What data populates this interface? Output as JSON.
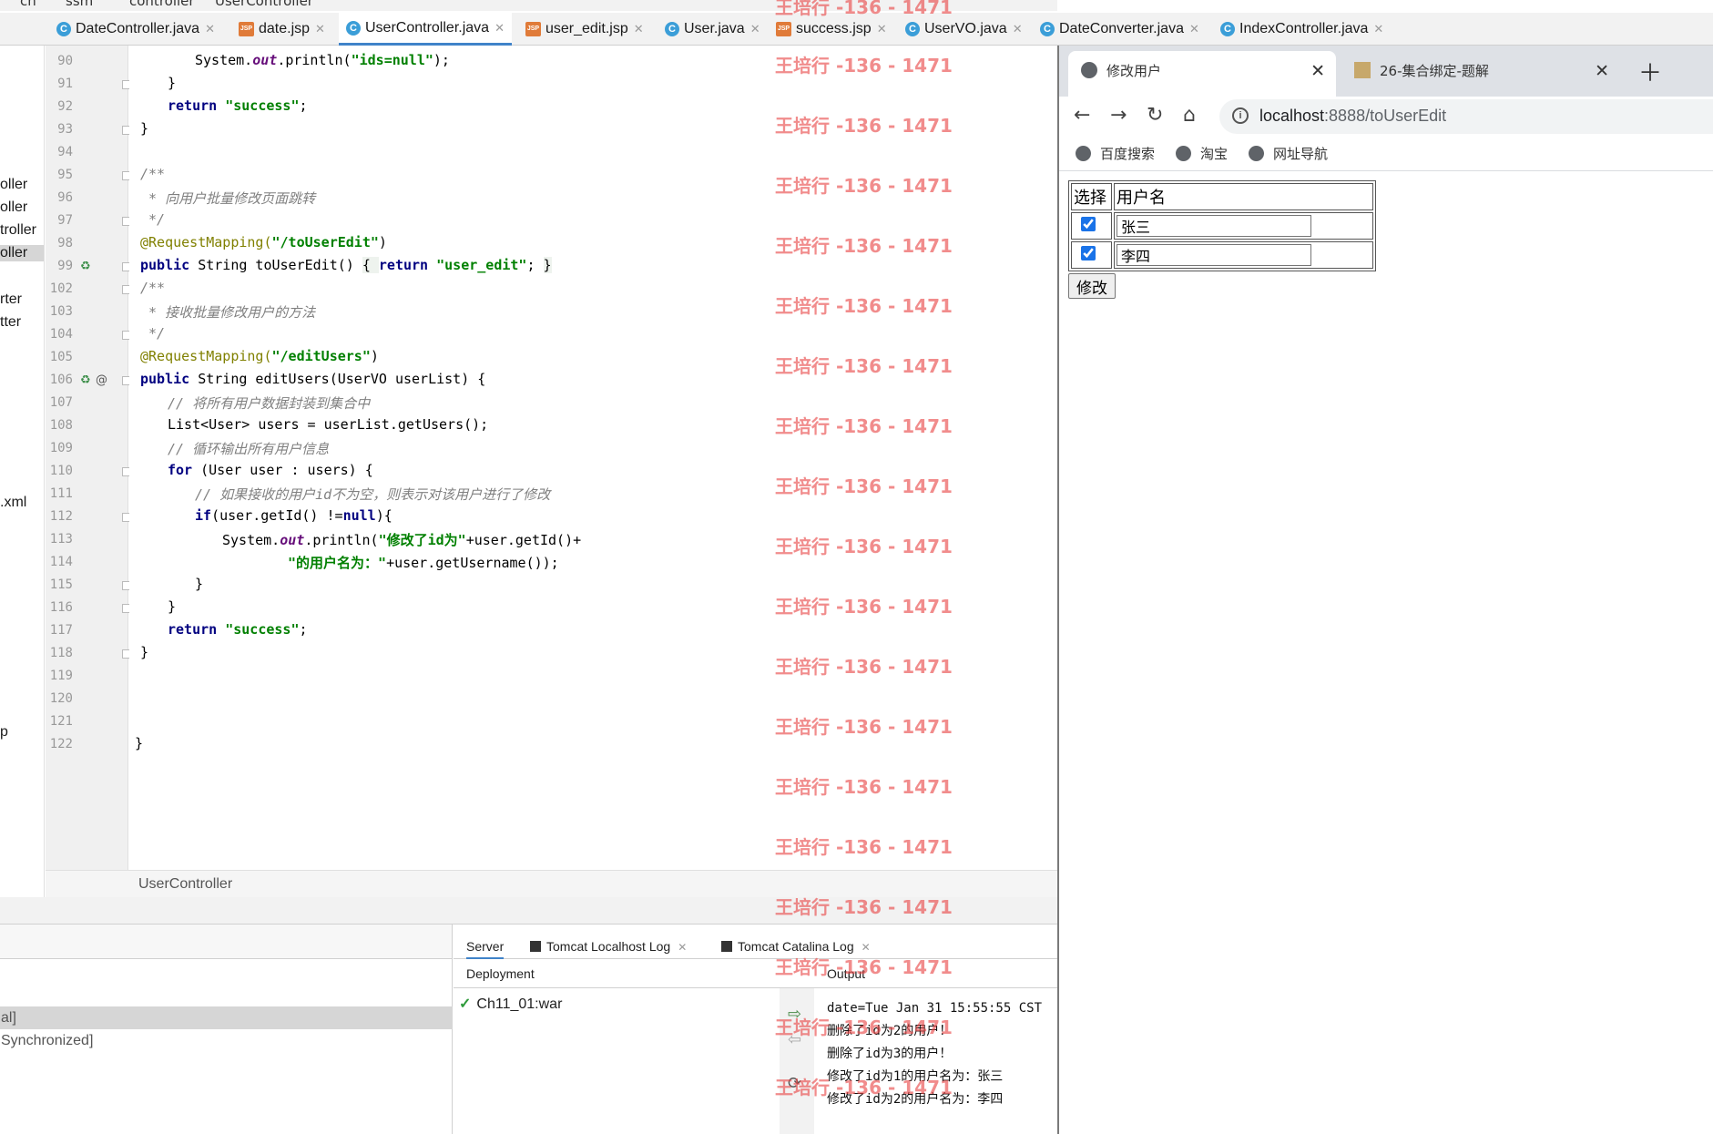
{
  "breadcrumb": [
    "cn",
    "ssm",
    "controller",
    "UserController"
  ],
  "editor_tabs": [
    {
      "label": "DateController.java",
      "kind": "class"
    },
    {
      "label": "date.jsp",
      "kind": "jsp"
    },
    {
      "label": "UserController.java",
      "kind": "class",
      "active": true
    },
    {
      "label": "user_edit.jsp",
      "kind": "jsp"
    },
    {
      "label": "User.java",
      "kind": "class"
    },
    {
      "label": "success.jsp",
      "kind": "jsp"
    },
    {
      "label": "UserVO.java",
      "kind": "class"
    },
    {
      "label": "DateConverter.java",
      "kind": "class"
    },
    {
      "label": "IndexController.java",
      "kind": "class"
    }
  ],
  "project_items": [
    "oller",
    "oller",
    "troller",
    "oller",
    "rter",
    "tter",
    ".xml",
    "p"
  ],
  "line_numbers": [
    "90",
    "91",
    "92",
    "93",
    "94",
    "95",
    "96",
    "97",
    "98",
    "99",
    "102",
    "103",
    "104",
    "105",
    "106",
    "107",
    "108",
    "109",
    "110",
    "111",
    "112",
    "113",
    "114",
    "115",
    "116",
    "117",
    "118",
    "119",
    "120",
    "121",
    "122"
  ],
  "code": {
    "l90_a": "System.",
    "l90_b": "out",
    "l90_c": ".println(",
    "l90_d": "\"ids=null\"",
    "l90_e": ");",
    "l91": "}",
    "l92_kw": "return",
    "l92_str": "\"success\"",
    "l92_end": ";",
    "l93": "}",
    "l95": "/**",
    "l96": " * 向用户批量修改页面跳转",
    "l97": " */",
    "l98_an": "@RequestMapping(",
    "l98_str": "\"/toUserEdit\"",
    "l98_end": ")",
    "l99_kw": "public",
    "l99_a": " String toUserEdit() ",
    "l99_b": "{ ",
    "l99_kw2": "return",
    "l99_str": " \"user_edit\"",
    "l99_c": "; ",
    "l99_d": "}",
    "l102": "/**",
    "l103": " * 接收批量修改用户的方法",
    "l104": " */",
    "l105_an": "@RequestMapping(",
    "l105_str": "\"/editUsers\"",
    "l105_end": ")",
    "l106_kw": "public",
    "l106_a": " String editUsers(UserVO userList) {",
    "l107": "// 将所有用户数据封装到集合中",
    "l108": "List<User> users = userList.getUsers();",
    "l109": "// 循环输出所有用户信息",
    "l110_kw": "for",
    "l110_a": " (User user : users) {",
    "l111": "// 如果接收的用户id不为空，则表示对该用户进行了修改",
    "l112_kw": "if",
    "l112_a": "(user.getId() !=",
    "l112_kw2": "null",
    "l112_b": "){",
    "l113_a": "System.",
    "l113_b": "out",
    "l113_c": ".println(",
    "l113_str": "\"修改了id为\"",
    "l113_d": "+user.getId()+",
    "l114_str": "\"的用户名为：\"",
    "l114_a": "+user.getUsername());",
    "l115": "}",
    "l116": "}",
    "l117_kw": "return",
    "l117_str": "\"success\"",
    "l117_end": ";",
    "l118": "}",
    "l122": "}"
  },
  "status_class": "UserController",
  "services": {
    "left_rows": [
      "al]",
      "Synchronized]"
    ],
    "tabs": [
      "Server",
      "Tomcat Localhost Log",
      "Tomcat Catalina Log"
    ],
    "deployment_label": "Deployment",
    "output_label": "Output",
    "deployment_item": "Ch11_01:war",
    "output_lines": [
      "date=Tue Jan 31 15:55:55 CST",
      "删除了id为2的用户！",
      "删除了id为3的用户！",
      "修改了id为1的用户名为：张三",
      "修改了id为2的用户名为：李四"
    ]
  },
  "watermark": "王培行 -136 - 1471",
  "browser": {
    "tabs": [
      {
        "title": "修改用户",
        "active": true
      },
      {
        "title": "26-集合绑定-题解",
        "active": false
      }
    ],
    "url_host": "localhost",
    "url_path": ":8888/toUserEdit",
    "bookmarks": [
      "百度搜索",
      "淘宝",
      "网址导航"
    ],
    "table_headers": [
      "选择",
      "用户名"
    ],
    "users": [
      {
        "checked": true,
        "name": "张三"
      },
      {
        "checked": true,
        "name": "李四"
      }
    ],
    "submit_label": "修改"
  },
  "colors": {
    "keyword": "#000080",
    "string": "#008000",
    "annotation": "#808000",
    "comment": "#808080",
    "watermark": "#e84646",
    "accent": "#4083c9"
  }
}
